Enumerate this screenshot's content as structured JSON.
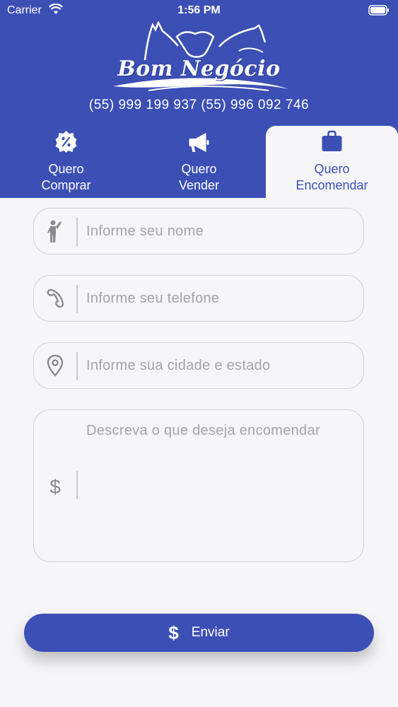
{
  "status": {
    "carrier": "Carrier",
    "time": "1:56 PM"
  },
  "header": {
    "logo_text": "Bom Negócio",
    "phones": "(55) 999 199 937 (55) 996 092 746"
  },
  "tabs": [
    {
      "label": "Quero\nComprar",
      "icon": "discount-badge-icon"
    },
    {
      "label": "Quero\nVender",
      "icon": "megaphone-icon"
    },
    {
      "label": "Quero\nEncomendar",
      "icon": "briefcase-icon"
    }
  ],
  "form": {
    "name_placeholder": "Informe seu nome",
    "phone_placeholder": "Informe seu telefone",
    "city_placeholder": "Informe sua cidade e estado",
    "description_placeholder": "Descreva o que deseja encomendar"
  },
  "submit": {
    "icon_text": "$",
    "label": "Enviar"
  },
  "colors": {
    "primary": "#3c4fb5",
    "background": "#f6f6f8",
    "border": "#cfcfd4"
  }
}
